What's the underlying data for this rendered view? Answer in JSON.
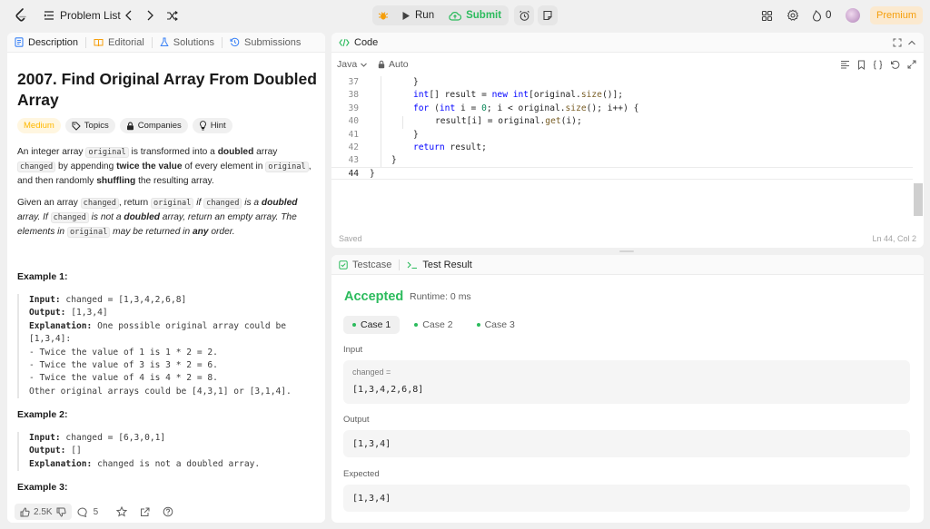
{
  "topbar": {
    "problem_list": "Problem List",
    "run": "Run",
    "submit": "Submit",
    "streak_count": "0",
    "premium": "Premium"
  },
  "left_tabs": [
    {
      "label": "Description",
      "icon": "description-icon"
    },
    {
      "label": "Editorial",
      "icon": "book-icon"
    },
    {
      "label": "Solutions",
      "icon": "flask-icon"
    },
    {
      "label": "Submissions",
      "icon": "history-icon"
    }
  ],
  "problem": {
    "title": "2007. Find Original Array From Doubled Array",
    "difficulty": "Medium",
    "tags": [
      "Topics",
      "Companies",
      "Hint"
    ],
    "para1": {
      "t1": "An integer array ",
      "c1": "original",
      "t2": " is transformed into a ",
      "b1": "doubled",
      "t3": " array ",
      "c2": "changed",
      "t4": " by appending ",
      "b2": "twice the value",
      "t5": " of every element in ",
      "c3": "original",
      "t6": ", and then randomly ",
      "b3": "shuffling",
      "t7": " the resulting array."
    },
    "para2": {
      "t1": "Given an array ",
      "c1": "changed",
      "t2": ", return ",
      "c2": "original",
      "t3": " if ",
      "c3": "changed",
      "t4": " is a ",
      "b1": "doubled",
      "t5": " array. If ",
      "c4": "changed",
      "t6": " is not a ",
      "b2": "doubled",
      "t7": " array, return an empty array. The elements in ",
      "c5": "original",
      "t8": " may be returned in ",
      "b3": "any",
      "t9": " order."
    },
    "examples": [
      {
        "title": "Example 1:",
        "input_label": "Input:",
        "input": " changed = [1,3,4,2,6,8]",
        "output_label": "Output:",
        "output": " [1,3,4]",
        "explanation_label": "Explanation:",
        "explanation_lines": [
          " One possible original array could be",
          "[1,3,4]:",
          "- Twice the value of 1 is 1 * 2 = 2.",
          "- Twice the value of 3 is 3 * 2 = 6.",
          "- Twice the value of 4 is 4 * 2 = 8.",
          "Other original arrays could be [4,3,1] or [3,1,4]."
        ]
      },
      {
        "title": "Example 2:",
        "input_label": "Input:",
        "input": " changed = [6,3,0,1]",
        "output_label": "Output:",
        "output": " []",
        "explanation_label": "Explanation:",
        "explanation": " changed is not a doubled array."
      },
      {
        "title": "Example 3:"
      }
    ],
    "likes": "2.5K",
    "comments": "5"
  },
  "code_panel": {
    "title": "Code",
    "language": "Java",
    "auto": "Auto",
    "status": "Saved",
    "cursor": "Ln 44, Col 2",
    "lines": [
      {
        "n": "37",
        "indent": 2,
        "code": "}"
      },
      {
        "n": "38",
        "indent": 2,
        "code": "int[] result = new int[original.size()];"
      },
      {
        "n": "39",
        "indent": 2,
        "code": "for (int i = 0; i < original.size(); i++) {"
      },
      {
        "n": "40",
        "indent": 3,
        "code": "result[i] = original.get(i);"
      },
      {
        "n": "41",
        "indent": 2,
        "code": "}"
      },
      {
        "n": "42",
        "indent": 2,
        "code": "return result;"
      },
      {
        "n": "43",
        "indent": 1,
        "code": "}"
      },
      {
        "n": "44",
        "indent": 0,
        "code": "}"
      }
    ]
  },
  "result_panel": {
    "tab_testcase": "Testcase",
    "tab_result": "Test Result",
    "verdict": "Accepted",
    "runtime": "Runtime: 0 ms",
    "cases": [
      "Case 1",
      "Case 2",
      "Case 3"
    ],
    "input_label": "Input",
    "input_name": "changed =",
    "input_value": "[1,3,4,2,6,8]",
    "output_label": "Output",
    "output_value": "[1,3,4]",
    "expected_label": "Expected",
    "expected_value": "[1,3,4]"
  },
  "colors": {
    "accent_green": "#2cbb5d",
    "premium_orange": "#f59e0b",
    "medium_yellow": "#ffb800"
  }
}
